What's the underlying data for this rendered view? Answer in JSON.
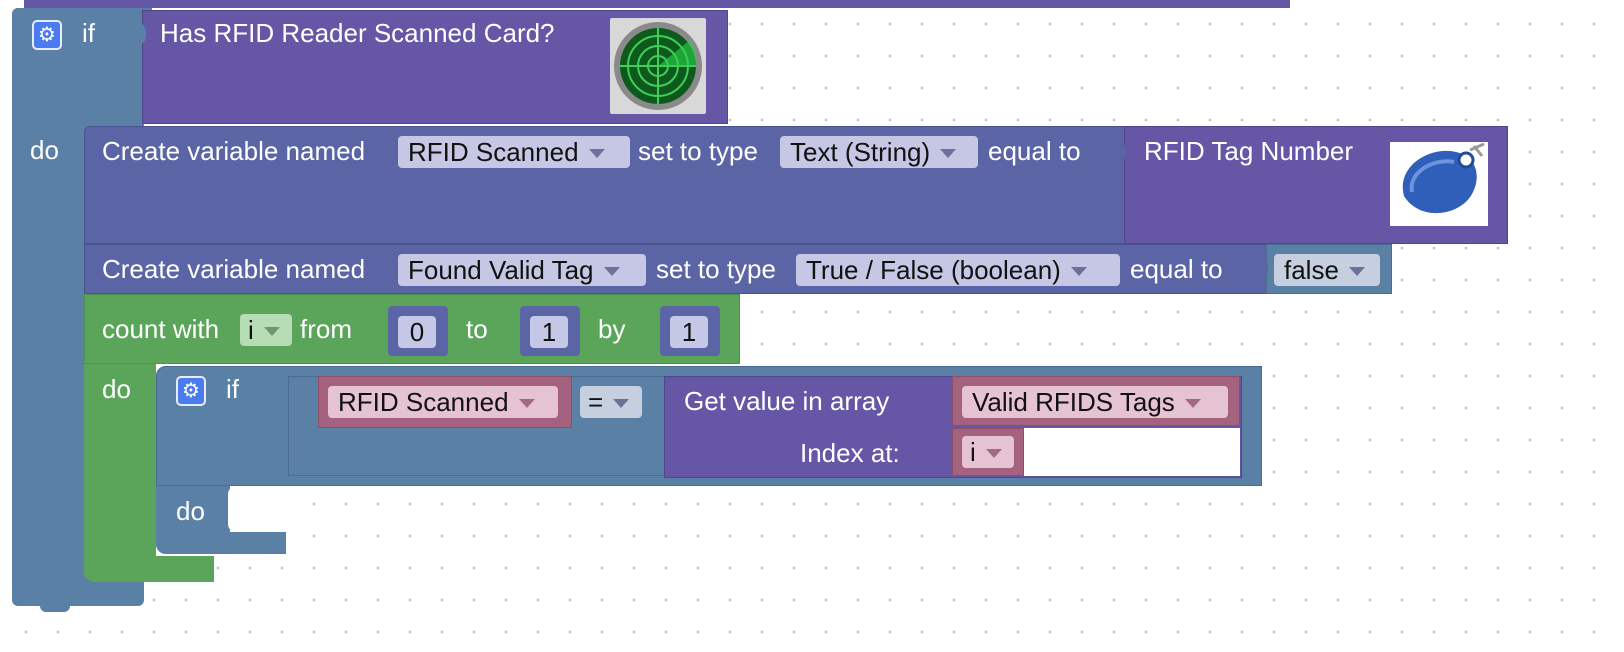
{
  "if_block": {
    "if_label": "if",
    "do_label": "do",
    "condition": "Has RFID Reader Scanned Card?"
  },
  "create_var_1": {
    "prefix": "Create variable named",
    "variable_name": "RFID Scanned",
    "type_prefix": "set to type",
    "type_value": "Text (String)",
    "equal_label": "equal to",
    "value_block": "RFID Tag Number"
  },
  "create_var_2": {
    "prefix": "Create variable named",
    "variable_name": "Found Valid Tag",
    "type_prefix": "set to type",
    "type_value": "True / False (boolean)",
    "equal_label": "equal to",
    "value": "false"
  },
  "count_block": {
    "label": "count with",
    "variable": "i",
    "from_label": "from",
    "from_value": "0",
    "to_label": "to",
    "to_value": "1",
    "by_label": "by",
    "by_value": "1",
    "do_label": "do"
  },
  "inner_if": {
    "if_label": "if",
    "do_label": "do",
    "left_var": "RFID Scanned",
    "operator": "=",
    "get_value_label": "Get value in array",
    "array_name": "Valid RFIDS Tags",
    "index_label": "Index at:",
    "index_var": "i"
  },
  "icons": {
    "gear": "gear-icon",
    "radar": "radar-image",
    "rfid_tag": "rfid-tag-image"
  },
  "colors": {
    "logic_blue": "#5b80a5",
    "purple_block": "#5b5ea6",
    "violet_block": "#6556a6",
    "loop_green": "#5ba55b",
    "variable_pink": "#a5627e",
    "dropdown_light": "#c5c7e5"
  }
}
